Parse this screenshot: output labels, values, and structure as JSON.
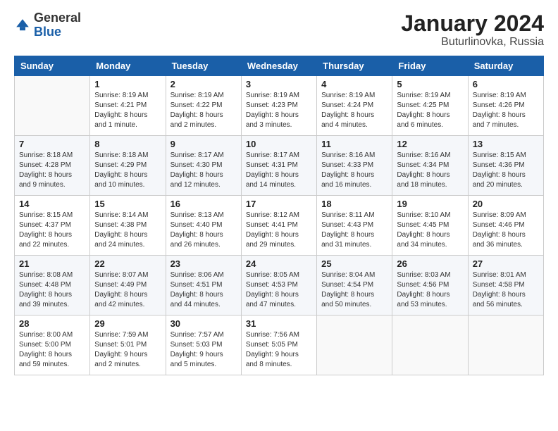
{
  "logo": {
    "general": "General",
    "blue": "Blue"
  },
  "header": {
    "title": "January 2024",
    "subtitle": "Buturlinovka, Russia"
  },
  "weekdays": [
    "Sunday",
    "Monday",
    "Tuesday",
    "Wednesday",
    "Thursday",
    "Friday",
    "Saturday"
  ],
  "weeks": [
    [
      {
        "day": "",
        "sunrise": "",
        "sunset": "",
        "daylight": ""
      },
      {
        "day": "1",
        "sunrise": "Sunrise: 8:19 AM",
        "sunset": "Sunset: 4:21 PM",
        "daylight": "Daylight: 8 hours and 1 minute."
      },
      {
        "day": "2",
        "sunrise": "Sunrise: 8:19 AM",
        "sunset": "Sunset: 4:22 PM",
        "daylight": "Daylight: 8 hours and 2 minutes."
      },
      {
        "day": "3",
        "sunrise": "Sunrise: 8:19 AM",
        "sunset": "Sunset: 4:23 PM",
        "daylight": "Daylight: 8 hours and 3 minutes."
      },
      {
        "day": "4",
        "sunrise": "Sunrise: 8:19 AM",
        "sunset": "Sunset: 4:24 PM",
        "daylight": "Daylight: 8 hours and 4 minutes."
      },
      {
        "day": "5",
        "sunrise": "Sunrise: 8:19 AM",
        "sunset": "Sunset: 4:25 PM",
        "daylight": "Daylight: 8 hours and 6 minutes."
      },
      {
        "day": "6",
        "sunrise": "Sunrise: 8:19 AM",
        "sunset": "Sunset: 4:26 PM",
        "daylight": "Daylight: 8 hours and 7 minutes."
      }
    ],
    [
      {
        "day": "7",
        "sunrise": "Sunrise: 8:18 AM",
        "sunset": "Sunset: 4:28 PM",
        "daylight": "Daylight: 8 hours and 9 minutes."
      },
      {
        "day": "8",
        "sunrise": "Sunrise: 8:18 AM",
        "sunset": "Sunset: 4:29 PM",
        "daylight": "Daylight: 8 hours and 10 minutes."
      },
      {
        "day": "9",
        "sunrise": "Sunrise: 8:17 AM",
        "sunset": "Sunset: 4:30 PM",
        "daylight": "Daylight: 8 hours and 12 minutes."
      },
      {
        "day": "10",
        "sunrise": "Sunrise: 8:17 AM",
        "sunset": "Sunset: 4:31 PM",
        "daylight": "Daylight: 8 hours and 14 minutes."
      },
      {
        "day": "11",
        "sunrise": "Sunrise: 8:16 AM",
        "sunset": "Sunset: 4:33 PM",
        "daylight": "Daylight: 8 hours and 16 minutes."
      },
      {
        "day": "12",
        "sunrise": "Sunrise: 8:16 AM",
        "sunset": "Sunset: 4:34 PM",
        "daylight": "Daylight: 8 hours and 18 minutes."
      },
      {
        "day": "13",
        "sunrise": "Sunrise: 8:15 AM",
        "sunset": "Sunset: 4:36 PM",
        "daylight": "Daylight: 8 hours and 20 minutes."
      }
    ],
    [
      {
        "day": "14",
        "sunrise": "Sunrise: 8:15 AM",
        "sunset": "Sunset: 4:37 PM",
        "daylight": "Daylight: 8 hours and 22 minutes."
      },
      {
        "day": "15",
        "sunrise": "Sunrise: 8:14 AM",
        "sunset": "Sunset: 4:38 PM",
        "daylight": "Daylight: 8 hours and 24 minutes."
      },
      {
        "day": "16",
        "sunrise": "Sunrise: 8:13 AM",
        "sunset": "Sunset: 4:40 PM",
        "daylight": "Daylight: 8 hours and 26 minutes."
      },
      {
        "day": "17",
        "sunrise": "Sunrise: 8:12 AM",
        "sunset": "Sunset: 4:41 PM",
        "daylight": "Daylight: 8 hours and 29 minutes."
      },
      {
        "day": "18",
        "sunrise": "Sunrise: 8:11 AM",
        "sunset": "Sunset: 4:43 PM",
        "daylight": "Daylight: 8 hours and 31 minutes."
      },
      {
        "day": "19",
        "sunrise": "Sunrise: 8:10 AM",
        "sunset": "Sunset: 4:45 PM",
        "daylight": "Daylight: 8 hours and 34 minutes."
      },
      {
        "day": "20",
        "sunrise": "Sunrise: 8:09 AM",
        "sunset": "Sunset: 4:46 PM",
        "daylight": "Daylight: 8 hours and 36 minutes."
      }
    ],
    [
      {
        "day": "21",
        "sunrise": "Sunrise: 8:08 AM",
        "sunset": "Sunset: 4:48 PM",
        "daylight": "Daylight: 8 hours and 39 minutes."
      },
      {
        "day": "22",
        "sunrise": "Sunrise: 8:07 AM",
        "sunset": "Sunset: 4:49 PM",
        "daylight": "Daylight: 8 hours and 42 minutes."
      },
      {
        "day": "23",
        "sunrise": "Sunrise: 8:06 AM",
        "sunset": "Sunset: 4:51 PM",
        "daylight": "Daylight: 8 hours and 44 minutes."
      },
      {
        "day": "24",
        "sunrise": "Sunrise: 8:05 AM",
        "sunset": "Sunset: 4:53 PM",
        "daylight": "Daylight: 8 hours and 47 minutes."
      },
      {
        "day": "25",
        "sunrise": "Sunrise: 8:04 AM",
        "sunset": "Sunset: 4:54 PM",
        "daylight": "Daylight: 8 hours and 50 minutes."
      },
      {
        "day": "26",
        "sunrise": "Sunrise: 8:03 AM",
        "sunset": "Sunset: 4:56 PM",
        "daylight": "Daylight: 8 hours and 53 minutes."
      },
      {
        "day": "27",
        "sunrise": "Sunrise: 8:01 AM",
        "sunset": "Sunset: 4:58 PM",
        "daylight": "Daylight: 8 hours and 56 minutes."
      }
    ],
    [
      {
        "day": "28",
        "sunrise": "Sunrise: 8:00 AM",
        "sunset": "Sunset: 5:00 PM",
        "daylight": "Daylight: 8 hours and 59 minutes."
      },
      {
        "day": "29",
        "sunrise": "Sunrise: 7:59 AM",
        "sunset": "Sunset: 5:01 PM",
        "daylight": "Daylight: 9 hours and 2 minutes."
      },
      {
        "day": "30",
        "sunrise": "Sunrise: 7:57 AM",
        "sunset": "Sunset: 5:03 PM",
        "daylight": "Daylight: 9 hours and 5 minutes."
      },
      {
        "day": "31",
        "sunrise": "Sunrise: 7:56 AM",
        "sunset": "Sunset: 5:05 PM",
        "daylight": "Daylight: 9 hours and 8 minutes."
      },
      {
        "day": "",
        "sunrise": "",
        "sunset": "",
        "daylight": ""
      },
      {
        "day": "",
        "sunrise": "",
        "sunset": "",
        "daylight": ""
      },
      {
        "day": "",
        "sunrise": "",
        "sunset": "",
        "daylight": ""
      }
    ]
  ]
}
